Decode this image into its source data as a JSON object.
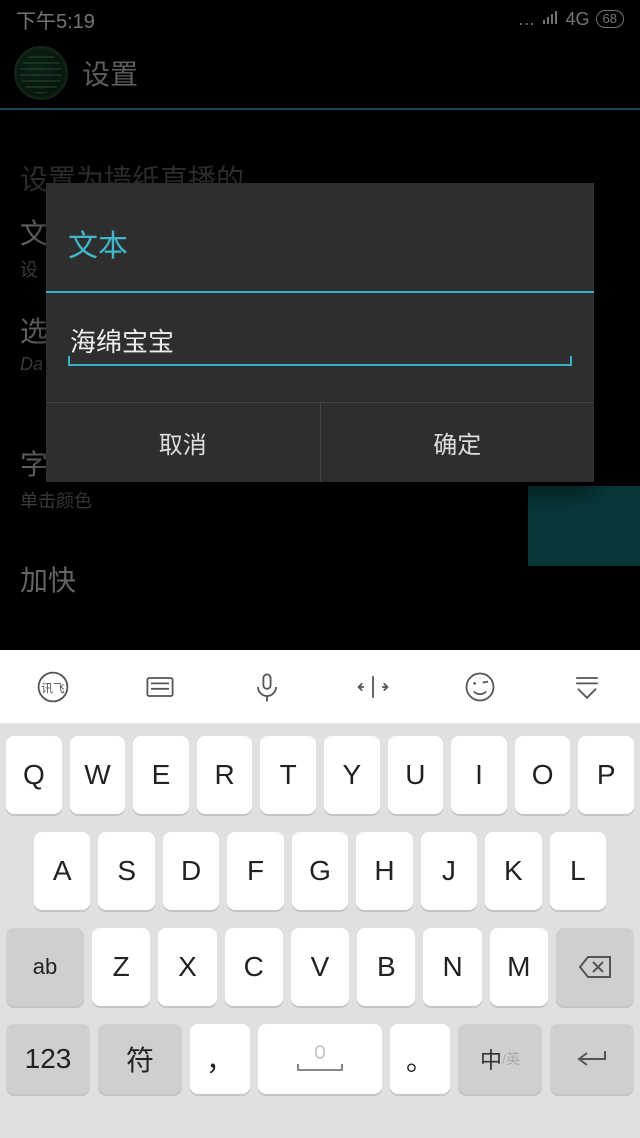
{
  "status": {
    "time": "下午5:19",
    "network": "4G",
    "battery": "68"
  },
  "appbar": {
    "title": "设置"
  },
  "background_rows": {
    "section_label": "设置为墙纸直播的",
    "text_row": "文",
    "text_sub": "设",
    "choose_row": "选",
    "choose_sub": "Da",
    "font_color_title": "字体颜色",
    "font_color_sub": "单击颜色",
    "speed_title": "加快"
  },
  "dialog": {
    "title": "文本",
    "input_value": "海绵宝宝",
    "cancel": "取消",
    "confirm": "确定"
  },
  "keyboard": {
    "rows": {
      "r1": [
        "Q",
        "W",
        "E",
        "R",
        "T",
        "Y",
        "U",
        "I",
        "O",
        "P"
      ],
      "r2": [
        "A",
        "S",
        "D",
        "F",
        "G",
        "H",
        "J",
        "K",
        "L"
      ],
      "r3_shift": "ab",
      "r3": [
        "Z",
        "X",
        "C",
        "V",
        "B",
        "N",
        "M"
      ],
      "r4_123": "123",
      "r4_sym": "符",
      "r4_comma": "，",
      "r4_period": "。",
      "r4_lang_main": "中",
      "r4_lang_sub": "/英"
    }
  }
}
